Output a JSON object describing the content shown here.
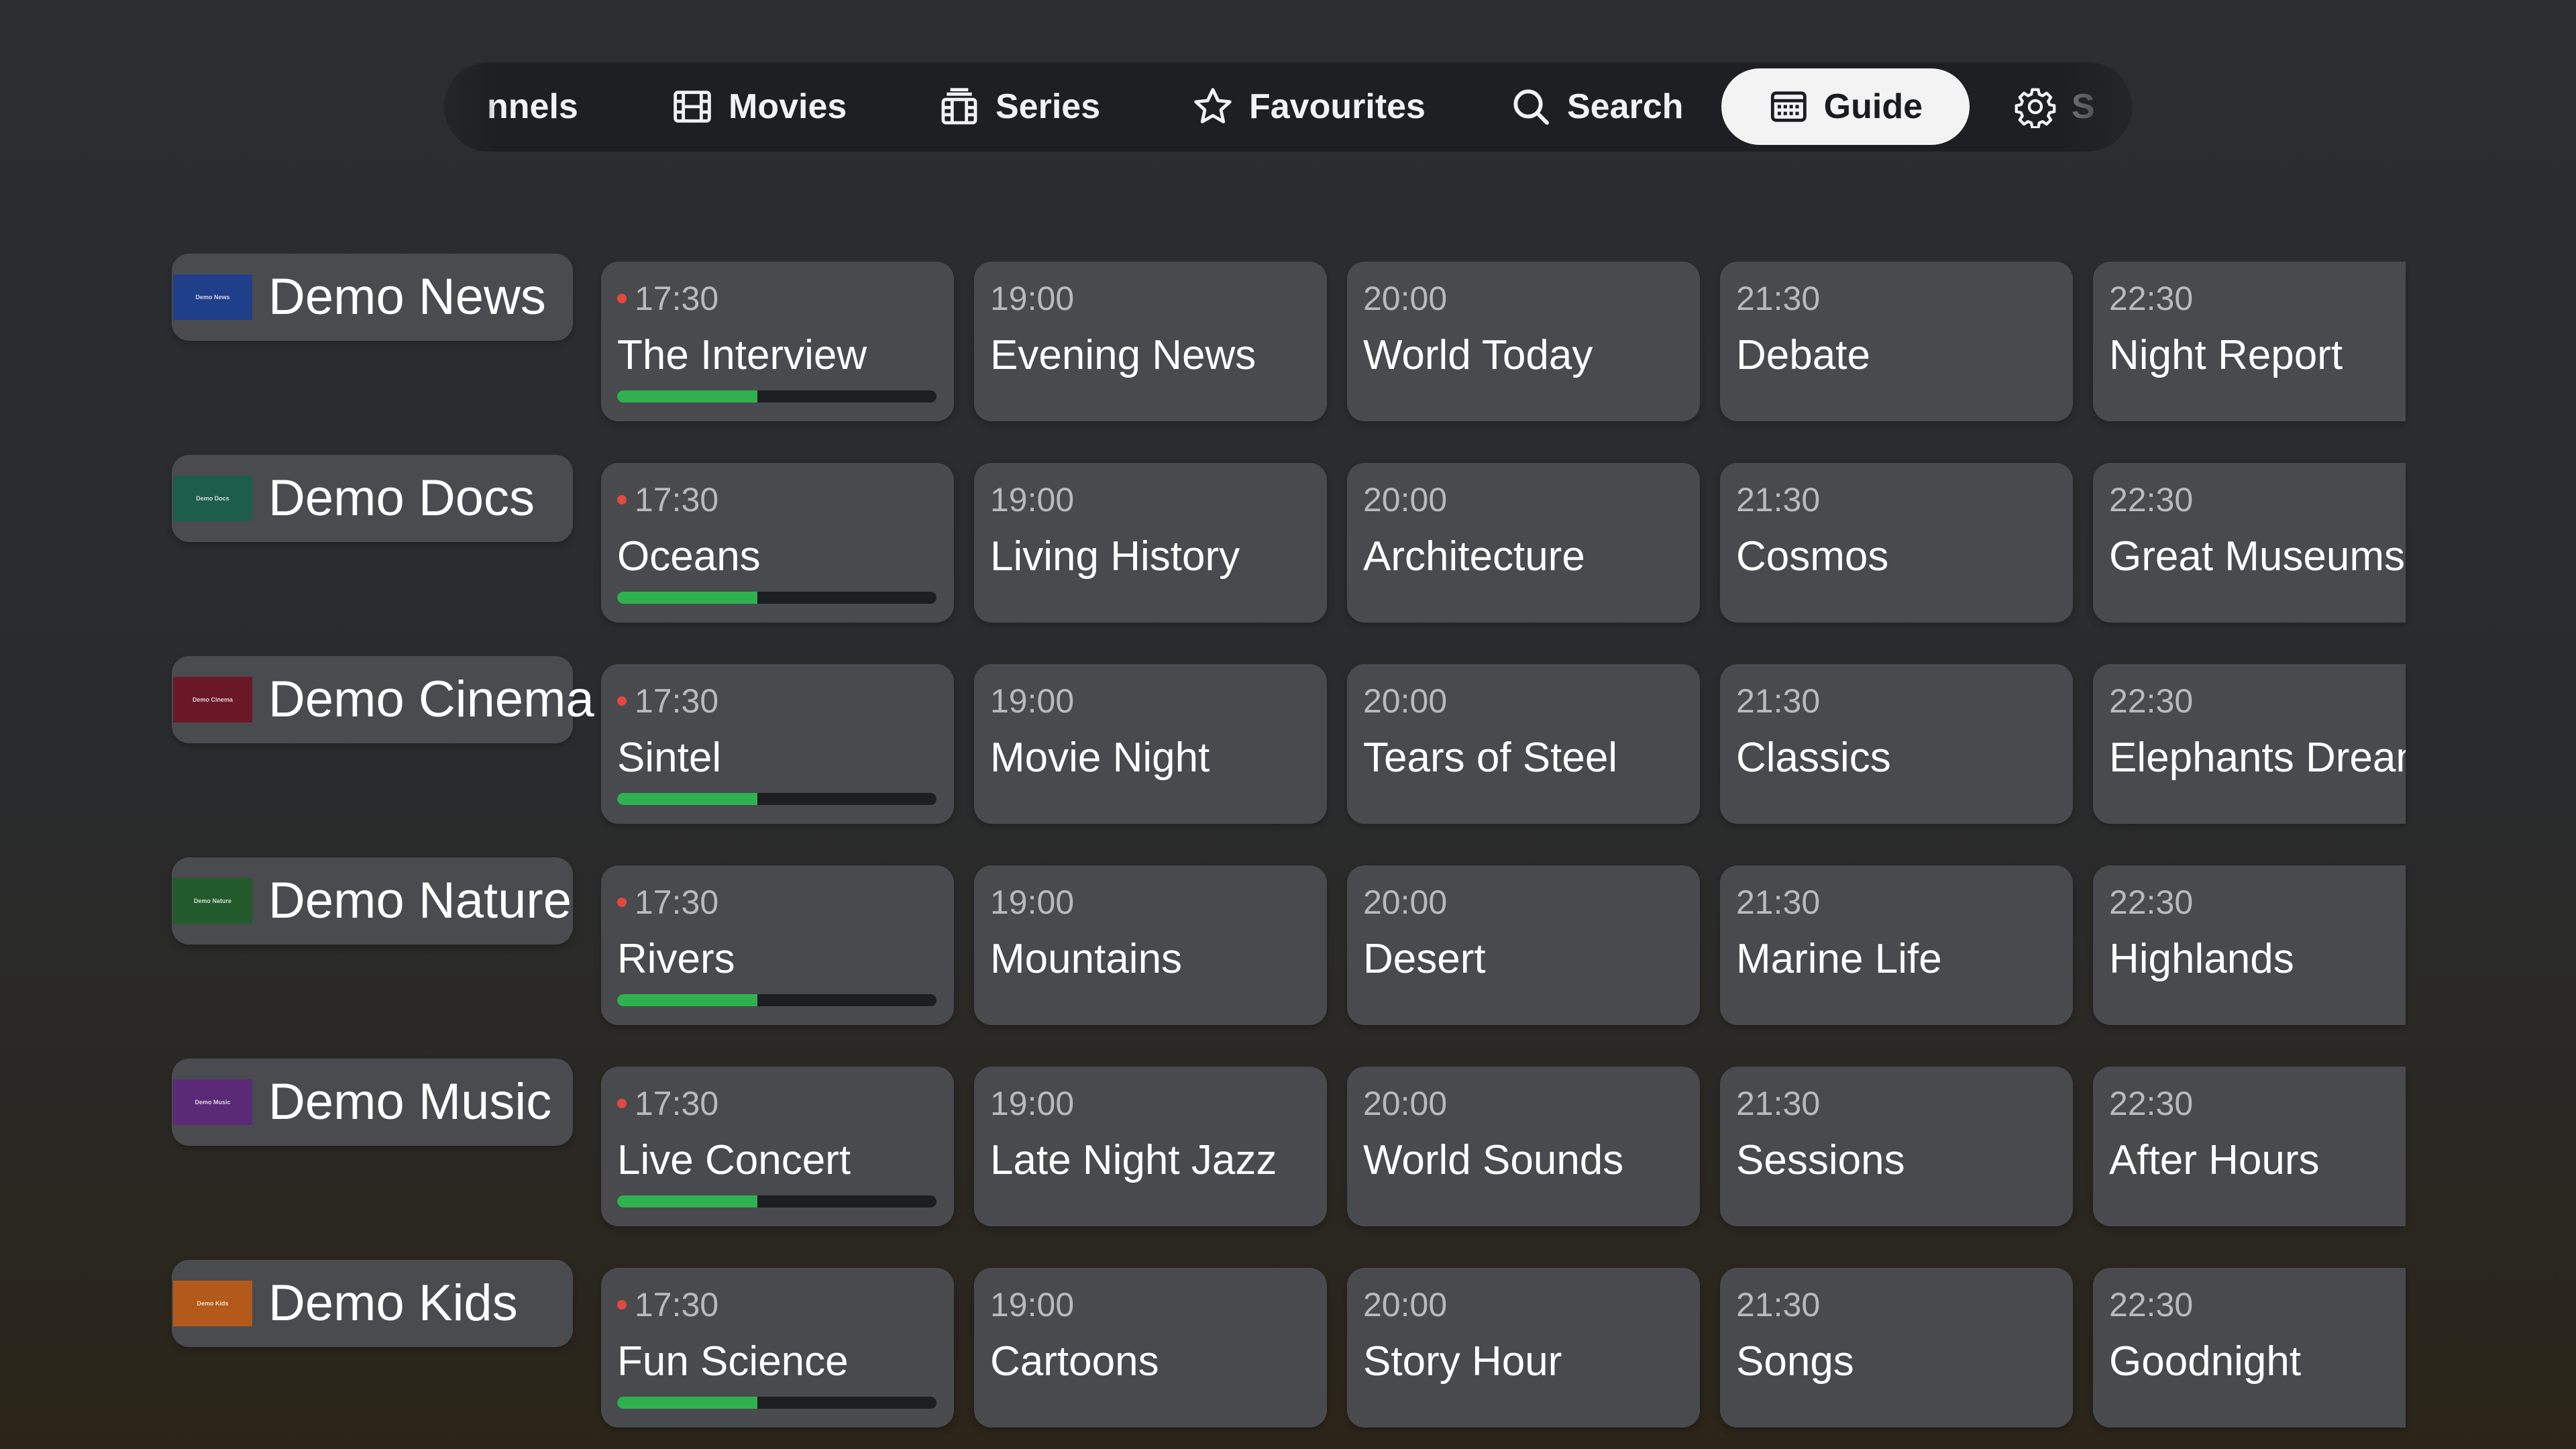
{
  "nav": {
    "items": [
      {
        "label": "Channels",
        "shown": "nnels",
        "icon": "tv-icon"
      },
      {
        "label": "Movies",
        "icon": "film-icon"
      },
      {
        "label": "Series",
        "icon": "series-icon"
      },
      {
        "label": "Favourites",
        "icon": "star-icon"
      },
      {
        "label": "Search",
        "icon": "search-icon"
      },
      {
        "label": "Guide",
        "icon": "calendar-icon",
        "active": true
      },
      {
        "label": "Settings",
        "shown": "S",
        "icon": "gear-icon"
      }
    ]
  },
  "guide": {
    "progress_color": "#2fb14f",
    "live_dot_color": "#e5483f",
    "channels": [
      {
        "name": "Demo News",
        "logo_text": "Demo News",
        "logo_color": "#1f3f8a",
        "programs": [
          {
            "time": "17:30",
            "title": "The Interview",
            "live": true,
            "progress": 0.44
          },
          {
            "time": "19:00",
            "title": "Evening News"
          },
          {
            "time": "20:00",
            "title": "World Today"
          },
          {
            "time": "21:30",
            "title": "Debate"
          },
          {
            "time": "22:30",
            "title": "Night Report"
          }
        ]
      },
      {
        "name": "Demo Docs",
        "logo_text": "Demo Docs",
        "logo_color": "#1d5e4a",
        "programs": [
          {
            "time": "17:30",
            "title": "Oceans",
            "live": true,
            "progress": 0.44
          },
          {
            "time": "19:00",
            "title": "Living History"
          },
          {
            "time": "20:00",
            "title": "Architecture"
          },
          {
            "time": "21:30",
            "title": "Cosmos"
          },
          {
            "time": "22:30",
            "title": "Great Museums"
          }
        ]
      },
      {
        "name": "Demo Cinema",
        "logo_text": "Demo Cinema",
        "logo_color": "#6a1828",
        "programs": [
          {
            "time": "17:30",
            "title": "Sintel",
            "live": true,
            "progress": 0.44
          },
          {
            "time": "19:00",
            "title": "Movie Night"
          },
          {
            "time": "20:00",
            "title": "Tears of Steel"
          },
          {
            "time": "21:30",
            "title": "Classics"
          },
          {
            "time": "22:30",
            "title": "Elephants Dream"
          }
        ]
      },
      {
        "name": "Demo Nature",
        "logo_text": "Demo Nature",
        "logo_color": "#235a2c",
        "programs": [
          {
            "time": "17:30",
            "title": "Rivers",
            "live": true,
            "progress": 0.44
          },
          {
            "time": "19:00",
            "title": "Mountains"
          },
          {
            "time": "20:00",
            "title": "Desert"
          },
          {
            "time": "21:30",
            "title": "Marine Life"
          },
          {
            "time": "22:30",
            "title": "Highlands"
          }
        ]
      },
      {
        "name": "Demo Music",
        "logo_text": "Demo Music",
        "logo_color": "#5a2a76",
        "programs": [
          {
            "time": "17:30",
            "title": "Live Concert",
            "live": true,
            "progress": 0.44
          },
          {
            "time": "19:00",
            "title": "Late Night Jazz"
          },
          {
            "time": "20:00",
            "title": "World Sounds"
          },
          {
            "time": "21:30",
            "title": "Sessions"
          },
          {
            "time": "22:30",
            "title": "After Hours"
          }
        ]
      },
      {
        "name": "Demo Kids",
        "logo_text": "Demo Kids",
        "logo_color": "#b35a1a",
        "programs": [
          {
            "time": "17:30",
            "title": "Fun Science",
            "live": true,
            "progress": 0.44
          },
          {
            "time": "19:00",
            "title": "Cartoons"
          },
          {
            "time": "20:00",
            "title": "Story Hour"
          },
          {
            "time": "21:30",
            "title": "Songs"
          },
          {
            "time": "22:30",
            "title": "Goodnight"
          }
        ]
      }
    ]
  }
}
